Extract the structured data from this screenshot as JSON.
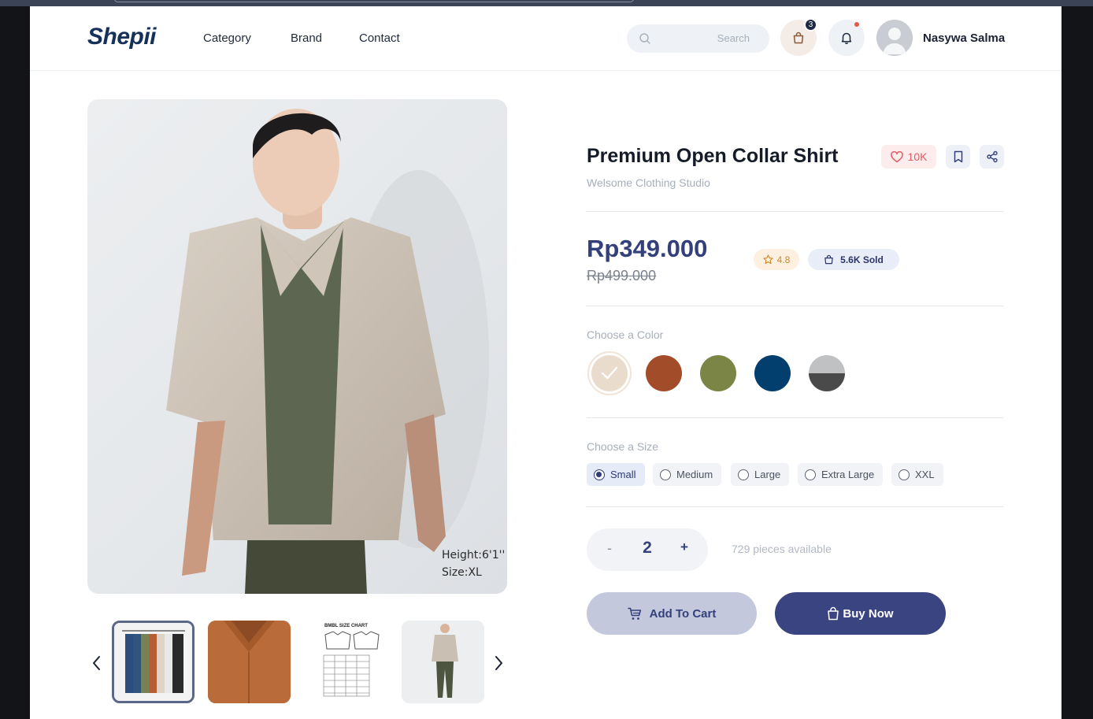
{
  "header": {
    "logo": "Shepii",
    "nav": [
      "Category",
      "Brand",
      "Contact"
    ],
    "search_placeholder": "Search",
    "cart_count": "3",
    "user_name": "Nasywa Salma"
  },
  "product": {
    "title": "Premium Open Collar Shirt",
    "store": "Welsome Clothing Studio",
    "likes": "10K",
    "price": "Rp349.000",
    "old_price": "Rp499.000",
    "rating": "4.8",
    "sold": "5.6K Sold",
    "image_caption_line1": "Height:6'1''",
    "image_caption_line2": "Size:XL",
    "size_chart_title": "BMBL SIZE CHART"
  },
  "colors": {
    "label": "Choose a Color",
    "swatches": [
      "#eadccc",
      "#a24c29",
      "#7b8546",
      "#023e6e",
      "#4a4a4a"
    ]
  },
  "sizes": {
    "label": "Choose a Size",
    "options": [
      "Small",
      "Medium",
      "Large",
      "Extra Large",
      "XXL"
    ],
    "selected": "Small"
  },
  "quantity": {
    "minus": "-",
    "value": "2",
    "plus": "+",
    "available": "729 pieces available"
  },
  "actions": {
    "add_to_cart": "Add To Cart",
    "buy_now": "Buy Now"
  },
  "theme": {
    "primary": "#3a4480",
    "primary_light": "#c3c8dc",
    "like_color": "#e25c68",
    "rating_color": "#d08a2c"
  }
}
